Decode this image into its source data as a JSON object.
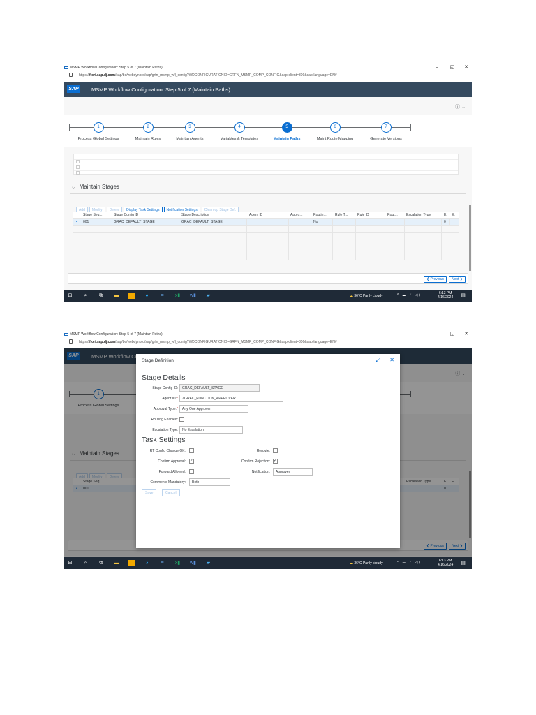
{
  "window": {
    "title": "MSMP Workflow Configuration: Step 5  of 7  (Maintain Paths)",
    "url_prefix": "https://",
    "url_host": "fiori.sap.dj.com",
    "url_rest": "/sap/bc/webdynpro/sap/grfn_msmp_wfl_config?WDCONFIGURATIONID=GRFN_MSMP_COMP_CONFIG&sap-client=300&sap-language=EN#",
    "minimize": "–",
    "restore": "◱",
    "close": "✕"
  },
  "shell": {
    "logo": "SAP",
    "title": "MSMP Workflow Configuration: Step 5  of 7  (Maintain Paths)",
    "title_short": "MSMP Workflow Co",
    "help": "ⓘ ⌄"
  },
  "wizard": {
    "steps": [
      {
        "num": "1",
        "label": "Process Global Settings"
      },
      {
        "num": "2",
        "label": "Maintain Rules"
      },
      {
        "num": "3",
        "label": "Maintain Agents"
      },
      {
        "num": "4",
        "label": "Variables & Templates"
      },
      {
        "num": "5",
        "label": "Maintain Paths"
      },
      {
        "num": "6",
        "label": "Maint Route Mapping"
      },
      {
        "num": "7",
        "label": "Generate Versions"
      }
    ],
    "active_step": 5
  },
  "stages": {
    "header": "Maintain Stages",
    "toolbar": {
      "add": "Add",
      "modify": "Modify",
      "delete": "Delete",
      "display_task": "Display Task Settings",
      "notification": "Notification Settings",
      "cleanup": "Clean-up Stage Def."
    },
    "columns": [
      "Stage Seq...",
      "Stage Config ID",
      "Stage Description",
      "Agent ID",
      "Appro...",
      "Routin...",
      "Rule T...",
      "Rule ID",
      "Rout...",
      "Escalation Type",
      "E.",
      "E."
    ],
    "rows": [
      {
        "seq": "001",
        "config_id": "GRAC_DEFAULT_STAGE",
        "description": "GRAC_DEFAULT_STAGE",
        "agent": "",
        "appro": "",
        "routing": "No",
        "rule_t": "",
        "rule_id": "",
        "rout": "",
        "escalation": "",
        "e1": "0",
        "e2": ""
      }
    ],
    "selected_marker": "•"
  },
  "footer": {
    "previous": "❮ Previous",
    "next": "Next ❯"
  },
  "taskbar": {
    "weather": "36°C  Partly cloudy",
    "time": "6:13 PM",
    "date": "4/16/2024",
    "tray": "^ ▬ ◜ ◁)"
  },
  "dialog": {
    "title": "Stage Definition",
    "stage_details": "Stage Details",
    "stage_config_label": "Stage Config ID:",
    "stage_config_value": "GRAC_DEFAULT_STAGE",
    "agent_label": "Agent ID:",
    "agent_value": "ZGRAC_FUNCTION_APPROVER",
    "approval_label": "Approval Type:",
    "approval_value": "Any One Approver",
    "routing_label": "Routing Enabled:",
    "escalation_label": "Escalation Type:",
    "escalation_value": "No Escalation",
    "task_settings": "Task Settings",
    "rt_label": "RT Config Change OK:",
    "reroute_label": "Reroute:",
    "confirm_approval_label": "Confirm Approval:",
    "confirm_rejection_label": "Confirm Rejection:",
    "forward_label": "Forward Allowed:",
    "notification_label": "Notification:",
    "notification_value": "Approver",
    "comments_label": "Comments Mandatory:",
    "comments_value": "Both",
    "save": "Save",
    "cancel": "Cancel",
    "checked_mark": "✓"
  }
}
